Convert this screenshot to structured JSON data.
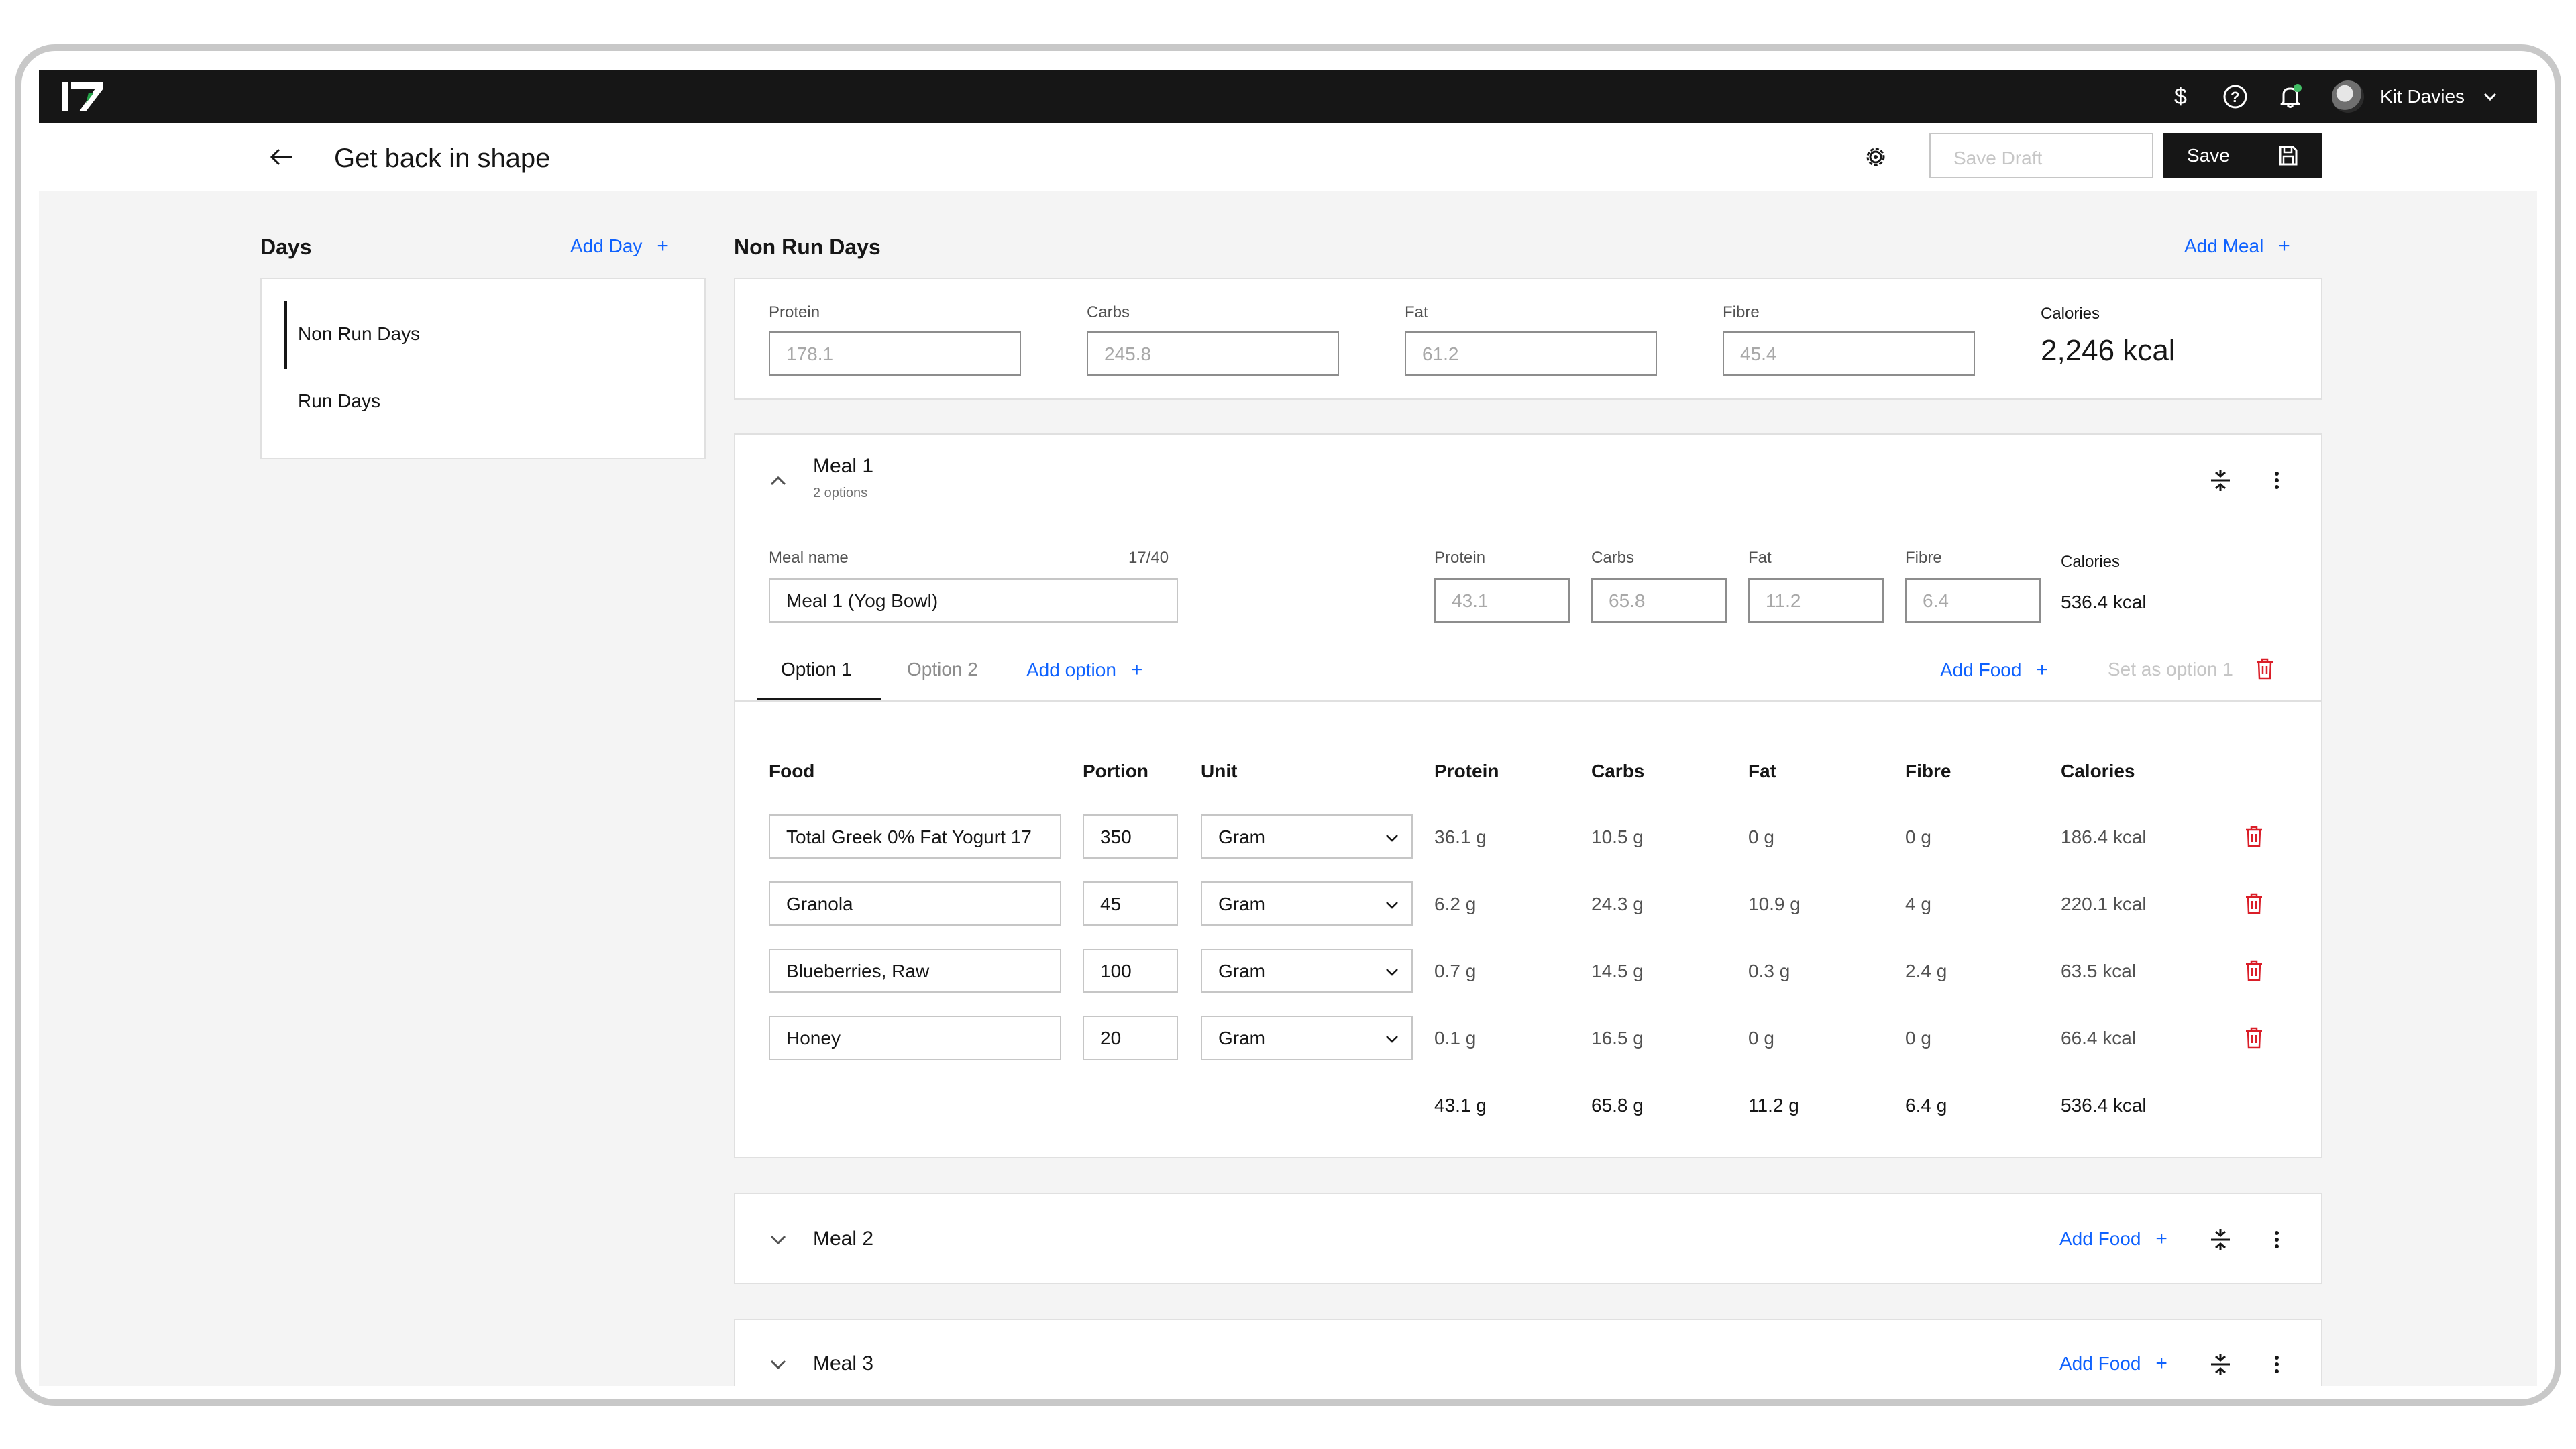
{
  "app": {
    "user_name": "Kit Davies",
    "accent_color": "#0f62fe",
    "danger_color": "#da1e28"
  },
  "header": {
    "title": "Get back in shape",
    "save_draft_label": "Save Draft",
    "save_label": "Save"
  },
  "days": {
    "title": "Days",
    "add_label": "Add Day",
    "items": [
      {
        "label": "Non Run Days",
        "active": true
      },
      {
        "label": "Run Days",
        "active": false
      }
    ]
  },
  "plan": {
    "title": "Non Run Days",
    "add_meal_label": "Add Meal",
    "macros": {
      "protein_label": "Protein",
      "protein": "178.1",
      "carbs_label": "Carbs",
      "carbs": "245.8",
      "fat_label": "Fat",
      "fat": "61.2",
      "fibre_label": "Fibre",
      "fibre": "45.4",
      "calories_label": "Calories",
      "calories": "2,246 kcal"
    }
  },
  "meal1": {
    "title": "Meal 1",
    "subtitle": "2 options",
    "name_label": "Meal name",
    "name_counter": "17/40",
    "name_value": "Meal 1 (Yog Bowl)",
    "protein_label": "Protein",
    "protein": "43.1",
    "carbs_label": "Carbs",
    "carbs": "65.8",
    "fat_label": "Fat",
    "fat": "11.2",
    "fibre_label": "Fibre",
    "fibre": "6.4",
    "calories_label": "Calories",
    "calories": "536.4 kcal",
    "tabs": [
      "Option 1",
      "Option 2"
    ],
    "add_option_label": "Add option",
    "add_food_label": "Add Food",
    "set_option_label": "Set as option 1",
    "columns": [
      "Food",
      "Portion",
      "Unit",
      "Protein",
      "Carbs",
      "Fat",
      "Fibre",
      "Calories"
    ],
    "rows": [
      {
        "food": "Total Greek 0% Fat Yogurt 17",
        "portion": "350",
        "unit": "Gram",
        "protein": "36.1 g",
        "carbs": "10.5 g",
        "fat": "0 g",
        "fibre": "0 g",
        "calories": "186.4 kcal"
      },
      {
        "food": "Granola",
        "portion": "45",
        "unit": "Gram",
        "protein": "6.2 g",
        "carbs": "24.3 g",
        "fat": "10.9 g",
        "fibre": "4 g",
        "calories": "220.1 kcal"
      },
      {
        "food": "Blueberries, Raw",
        "portion": "100",
        "unit": "Gram",
        "protein": "0.7 g",
        "carbs": "14.5 g",
        "fat": "0.3 g",
        "fibre": "2.4 g",
        "calories": "63.5 kcal"
      },
      {
        "food": "Honey",
        "portion": "20",
        "unit": "Gram",
        "protein": "0.1 g",
        "carbs": "16.5 g",
        "fat": "0 g",
        "fibre": "0 g",
        "calories": "66.4 kcal"
      }
    ],
    "totals": {
      "protein": "43.1 g",
      "carbs": "65.8 g",
      "fat": "11.2 g",
      "fibre": "6.4 g",
      "calories": "536.4 kcal"
    }
  },
  "meal2": {
    "title": "Meal 2",
    "add_food_label": "Add Food"
  },
  "meal3": {
    "title": "Meal 3",
    "add_food_label": "Add Food"
  }
}
